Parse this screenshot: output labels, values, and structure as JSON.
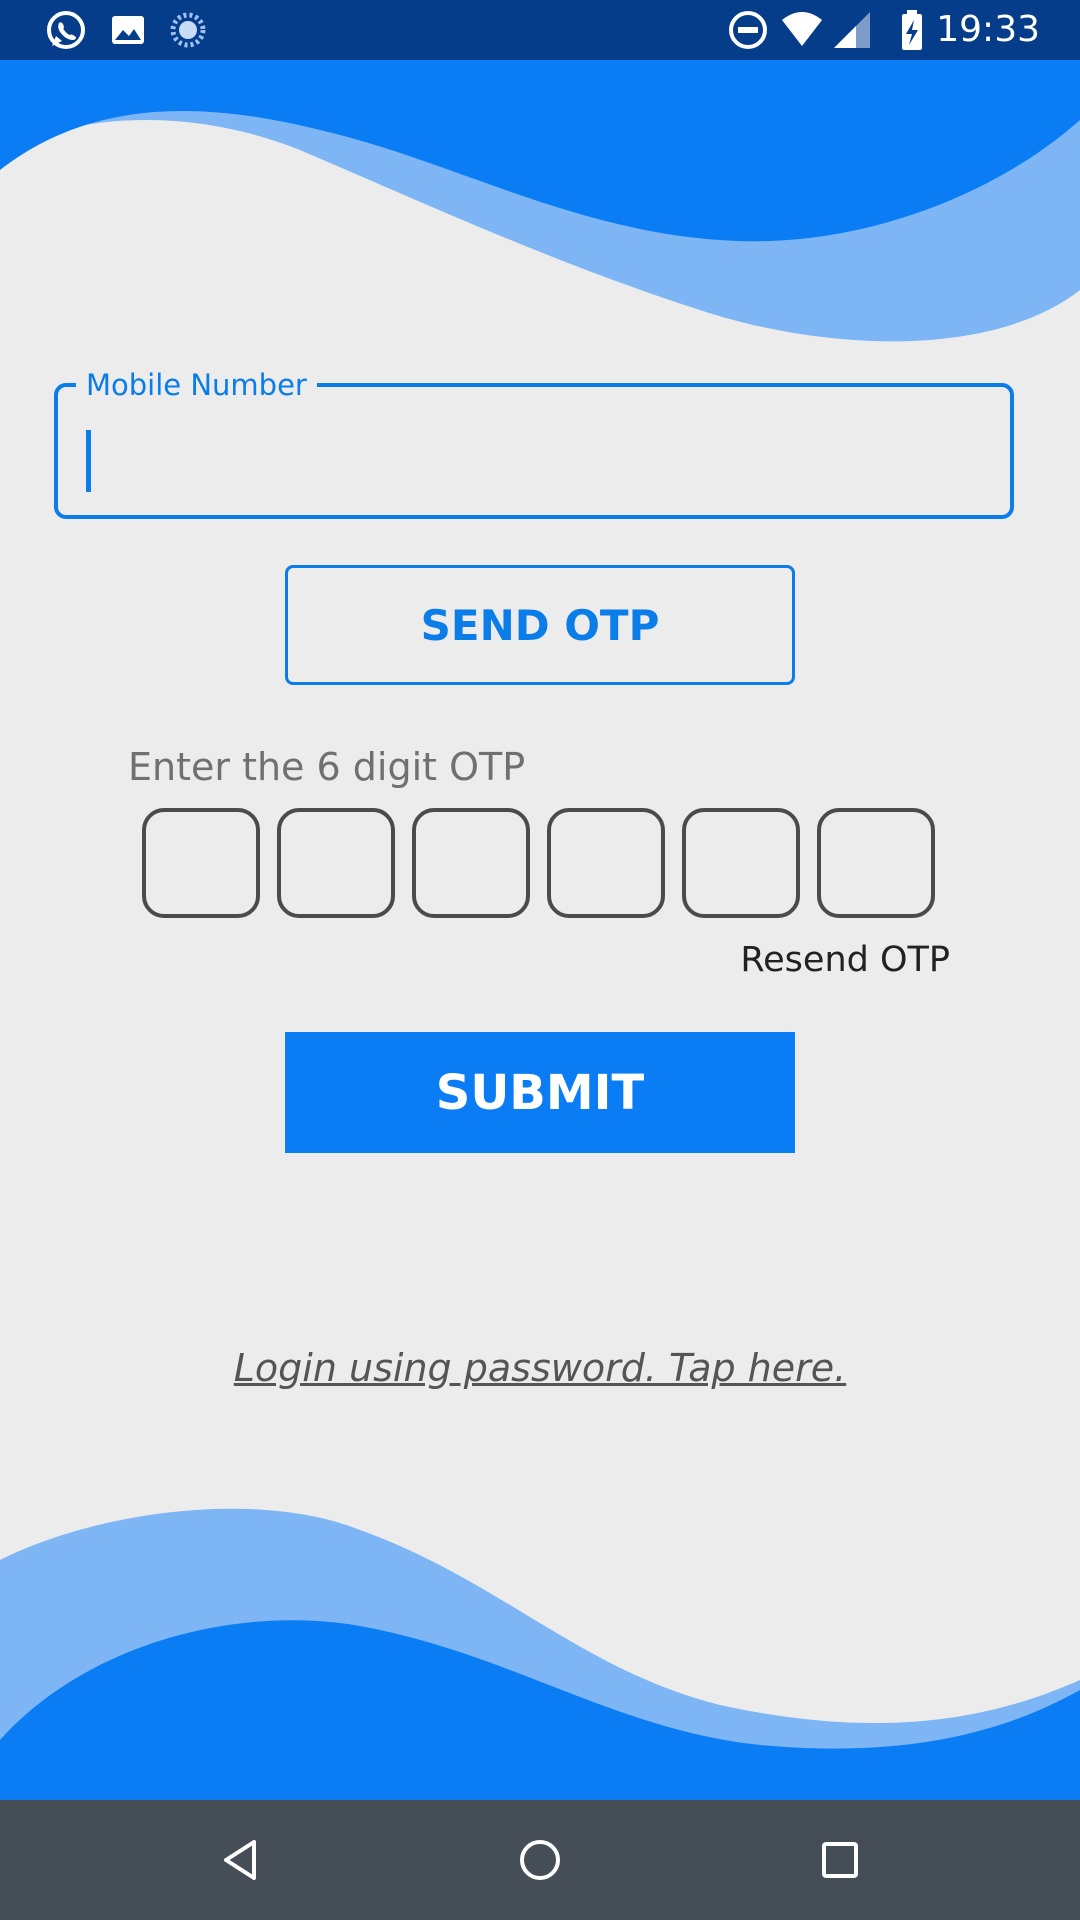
{
  "status_bar": {
    "time": "19:33",
    "left_icons": [
      "whatsapp-icon",
      "image-icon",
      "sync-icon"
    ],
    "right_icons": [
      "do-not-disturb-icon",
      "wifi-icon",
      "signal-icon",
      "battery-charging-icon"
    ]
  },
  "form": {
    "mobile_label": "Mobile Number",
    "mobile_value": "",
    "send_otp_label": "SEND OTP",
    "otp_prompt": "Enter the 6 digit OTP",
    "otp_digits": [
      "",
      "",
      "",
      "",
      "",
      ""
    ],
    "resend_label": "Resend OTP",
    "submit_label": "SUBMIT",
    "password_login_link": "Login using password. Tap here."
  },
  "nav_bar": {
    "buttons": [
      "back-icon",
      "home-icon",
      "recents-icon"
    ]
  },
  "colors": {
    "accent": "#0a7df5",
    "wave_light": "#7db5f5",
    "status_bar": "#063d8a",
    "nav_bar": "#454d56",
    "background": "#ececed"
  }
}
